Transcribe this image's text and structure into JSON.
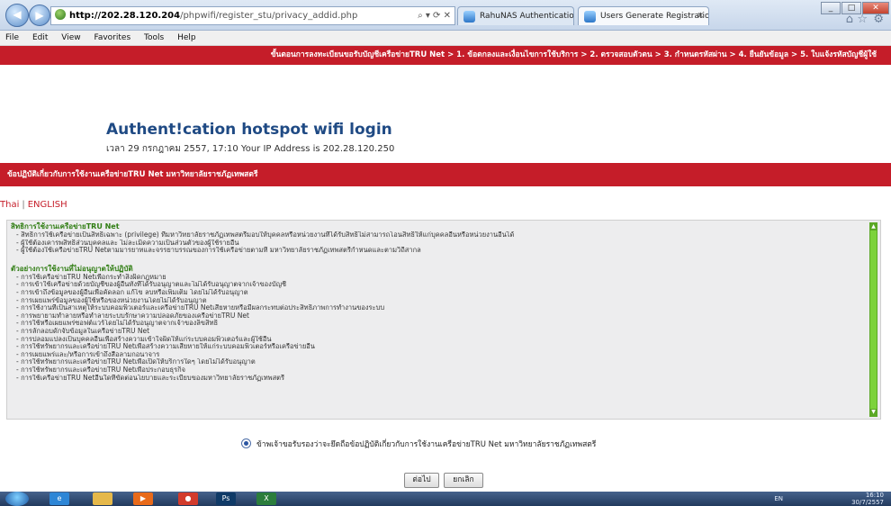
{
  "browser": {
    "url_host": "http://202.28.120.204",
    "url_path": "/phpwifi/register_stu/privacy_addid.php",
    "address_controls": "⌕ ▾ ⟳ ✕",
    "tabs": [
      {
        "label": "RahuNAS Authentication"
      },
      {
        "label": "Users Generate Registration...",
        "close": "✕"
      }
    ]
  },
  "menu": [
    "File",
    "Edit",
    "View",
    "Favorites",
    "Tools",
    "Help"
  ],
  "page": {
    "steps_text": "ขั้นตอนการลงทะเบียนขอรับบัญชีเครือข่ายTRU Net > 1. ข้อตกลงและเงื่อนไขการใช้บริการ > 2. ตรวจสอบตัวตน > 3. กำหนดรหัสผ่าน > 4. ยืนยันข้อมูล > 5. ใบแจ้งรหัสบัญชีผู้ใช้",
    "title": "Authent!cation hotspot wifi login",
    "subtitle": "เวลา 29 กรกฎาคม 2557, 17:10 Your IP Address is 202.28.120.250",
    "terms_header": "ข้อปฏิบัติเกี่ยวกับการใช้งานเครือข่ายTRU Net มหาวิทยาลัยราชภัฏเทพสตรี",
    "lang_thai": "Thai",
    "lang_sep": "|",
    "lang_english": "ENGLISH",
    "section1_title": "สิทธิการใช้งานเครือข่ายTRU Net",
    "section1_lines": [
      "- สิทธิการใช้เครือข่ายเป็นสิทธิเฉพาะ (privilege) ที่มหาวิทยาลัยราชภัฏเทพสตรีมอบให้บุคคลหรือหน่วยงานที่ได้รับสิทธิ์ไม่สามารถโอนสิทธิ์ให้แก่บุคคลอื่นหรือหน่วยงานอื่นได้",
      "- ผู้ใช้ต้องเคารพสิทธิส่วนบุคคลและ ไม่ละเมิดความเป็นส่วนตัวของผู้ใช้รายอื่น",
      "- ผู้ใช้ต้องใช้เครือข่ายTRU Netตามมารยาทและจรรยาบรรณของการใช้เครือข่ายตามที่ มหาวิทยาลัยราชภัฏเทพสตรีกำหนดและตามวิถีสากล"
    ],
    "section2_title": "ตัวอย่างการใช้งานที่ไม่อนุญาตให้ปฏิบัติ",
    "section2_lines": [
      "- การใช้เครือข่ายTRU Netเพื่อกระทำสิ่งผิดกฎหมาย",
      "- การเข้าใช้เครือข่ายด้วยบัญชีของผู้อื่นทั้งที่ได้รับอนุญาตและไม่ได้รับอนุญาตจากเจ้าของบัญชี",
      "- การเข้าถึงข้อมูลของผู้อื่นเพื่อคัดลอก แก้ไข ลบหรือเพิ่มเติม โดยไม่ได้รับอนุญาต",
      "- การเผยแพร่ข้อมูลของผู้ใช้หรือของหน่วยงานโดยไม่ได้รับอนุญาต",
      "- การใช้งานที่เป็นสาเหตุให้ระบบคอมพิวเตอร์และเครือข่ายTRU Netเสียหายหรือมีผลกระทบต่อประสิทธิภาพการทำงานของระบบ",
      "- การพยายามทำลายหรือทำลายระบบรักษาความปลอดภัยของเครือข่ายTRU Net",
      "- การใช้หรือเผยแพร่ซอฟต์แวร์โดยไม่ได้รับอนุญาตจากเจ้าของลิขสิทธิ์",
      "- การลักลอบดักจับข้อมูลในเครือข่ายTRU Net",
      "- การปลอมแปลงเป็นบุคคลอื่นเพื่อสร้างความเข้าใจผิดให้แก่ระบบคอมพิวเตอร์และผู้ใช้อื่น",
      "- การใช้ทรัพยากรและเครือข่ายTRU Netเพื่อสร้างความเสียหายให้แก่ระบบคอมพิวเตอร์หรือเครือข่ายอื่น",
      "- การเผยแพร่และ/หรือการเข้าถึงสื่อลามกอนาจาร",
      "- การใช้ทรัพยากรและเครือข่ายTRU Netเพื่อเปิดให้บริการใดๆ โดยไม่ได้รับอนุญาต",
      "- การใช้ทรัพยากรและเครือข่ายTRU Netเพื่อประกอบธุรกิจ",
      "- การใช้เครือข่ายTRU Netอื่นใดที่ขัดต่อนโยบายและระเบียบของมหาวิทยาลัยราชภัฏเทพสตรี"
    ],
    "agree_text": "ข้าพเจ้าขอรับรองว่าจะยึดถือข้อปฏิบัติเกี่ยวกับการใช้งานเครือข่ายTRU Net มหาวิทยาลัยราชภัฏเทพสตรี",
    "next_label": "ต่อไป",
    "cancel_label": "ยกเลิก"
  },
  "taskbar": {
    "lang": "EN",
    "clock_time": "16:10",
    "clock_date": "30/7/2557",
    "ps_label": "Ps"
  },
  "colors": {
    "brand_red": "#c51d29",
    "title_blue": "#1f4a84",
    "section_green": "#2f7d12",
    "scrollbar_green": "#7cd23c"
  }
}
